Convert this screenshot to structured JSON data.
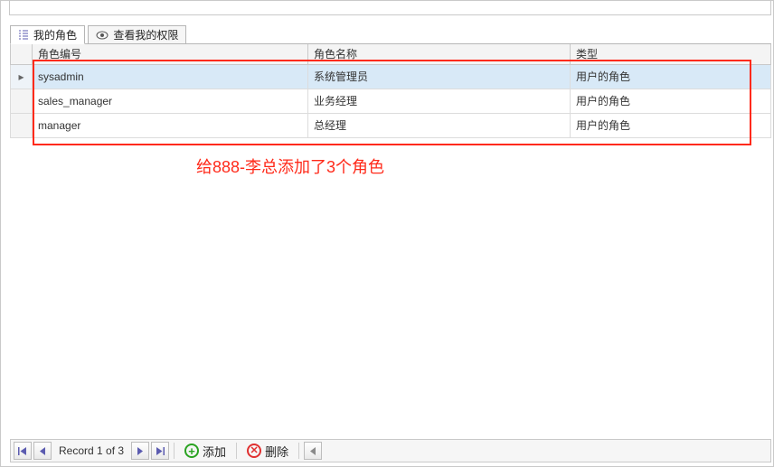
{
  "tabs": [
    {
      "label": "我的角色",
      "icon": "list-icon",
      "active": true
    },
    {
      "label": "查看我的权限",
      "icon": "eye-icon",
      "active": false
    }
  ],
  "columns": {
    "id": "角色编号",
    "name": "角色名称",
    "type": "类型"
  },
  "rows": [
    {
      "id": "sysadmin",
      "name": "系统管理员",
      "type": "用户的角色",
      "selected": true
    },
    {
      "id": "sales_manager",
      "name": "业务经理",
      "type": "用户的角色",
      "selected": false
    },
    {
      "id": "manager",
      "name": "总经理",
      "type": "用户的角色",
      "selected": false
    }
  ],
  "annotation": "给888-李总添加了3个角色",
  "navigator": {
    "record_label": "Record 1 of 3",
    "add_label": "添加",
    "delete_label": "删除"
  },
  "row_indicator": "▸"
}
